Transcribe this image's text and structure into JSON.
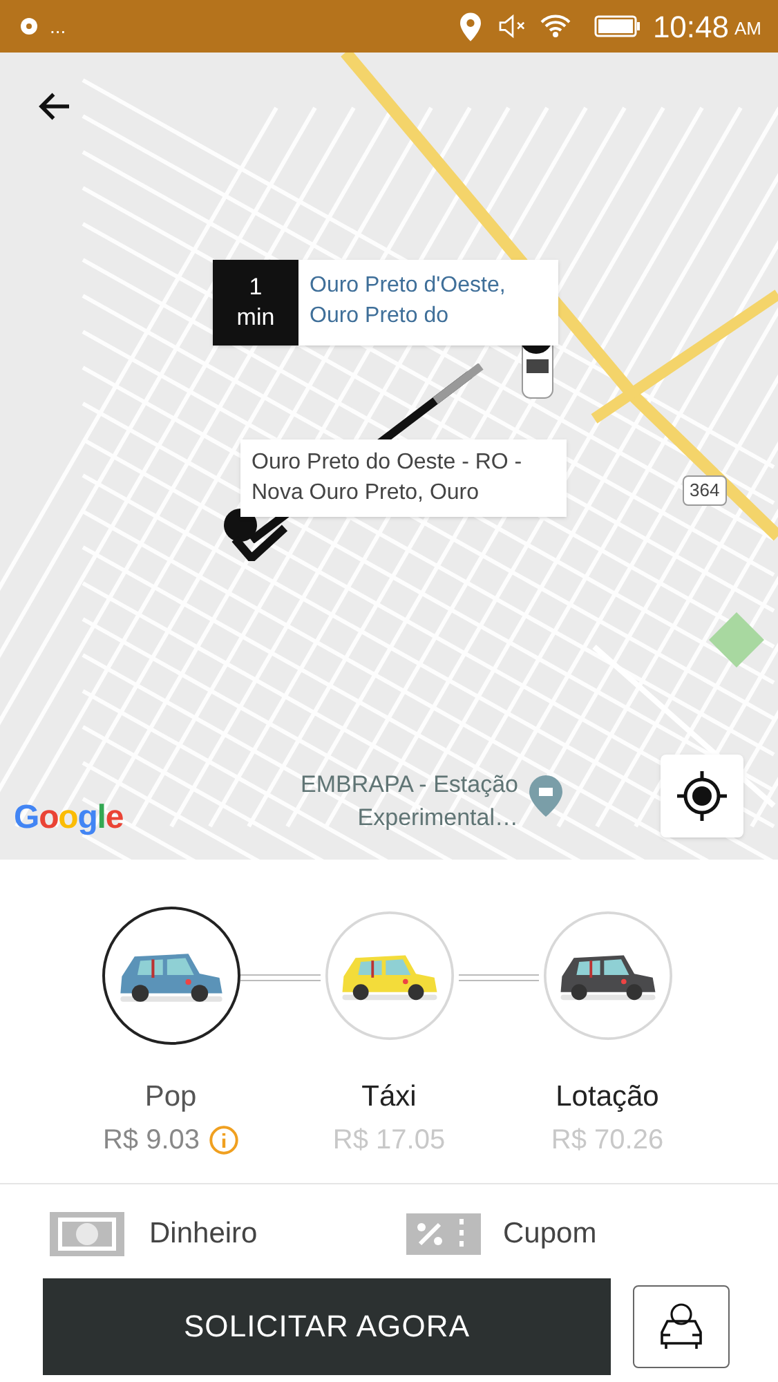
{
  "status_bar": {
    "overflow": "...",
    "time": "10:48",
    "ampm": "AM"
  },
  "map": {
    "eta": {
      "value": "1",
      "unit": "min"
    },
    "pickup_label": "Ouro Preto d'Oeste, Ouro Preto do",
    "destination_label": "Ouro Preto do Oeste - RO - Nova Ouro Preto, Ouro",
    "road_shield": "364",
    "poi": "EMBRAPA - Estação Experimental…",
    "logo": "Google"
  },
  "ride_options": [
    {
      "name": "Pop",
      "price": "R$ 9.03",
      "selected": true,
      "color": "#5b93b8",
      "info": true
    },
    {
      "name": "Táxi",
      "price": "R$ 17.05",
      "selected": false,
      "color": "#f3dc3a",
      "info": false
    },
    {
      "name": "Lotação",
      "price": "R$ 70.26",
      "selected": false,
      "color": "#4a4a4c",
      "info": false
    }
  ],
  "payment": {
    "method": "Dinheiro",
    "coupon": "Cupom"
  },
  "request_button": "SOLICITAR AGORA"
}
